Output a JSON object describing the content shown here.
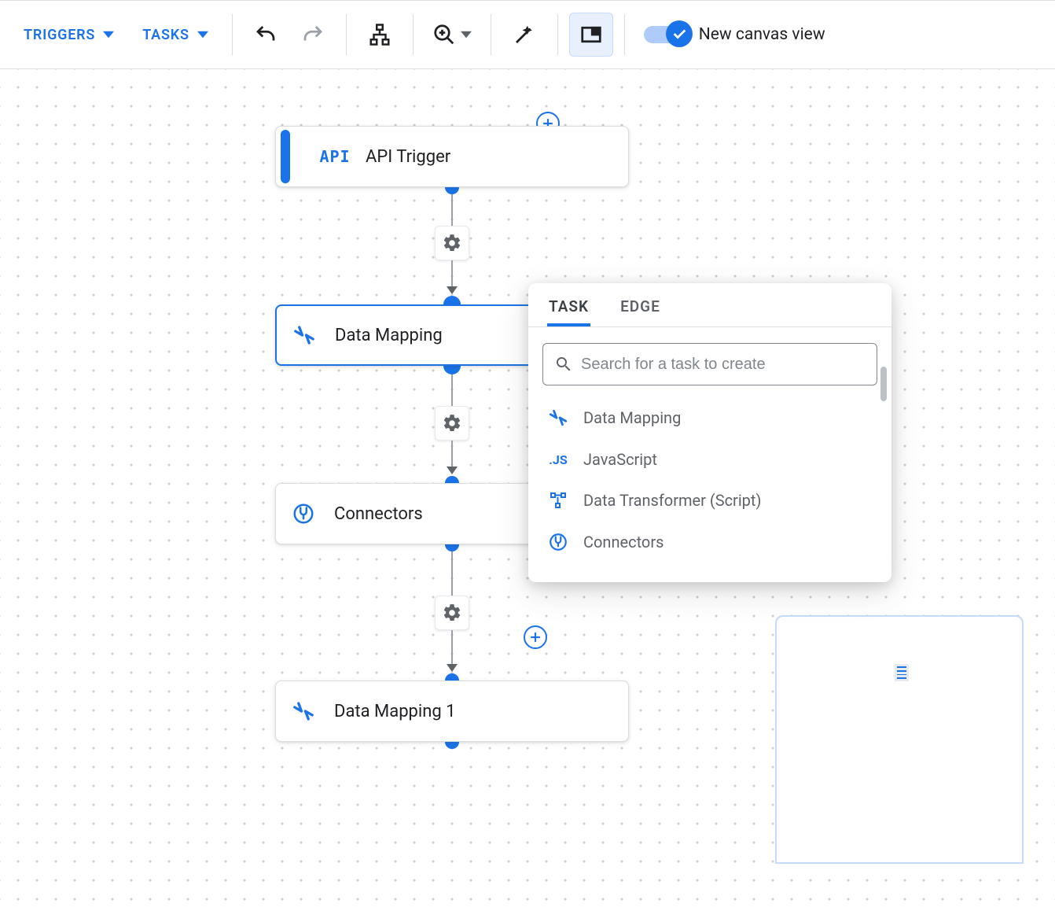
{
  "toolbar": {
    "triggers_label": "TRIGGERS",
    "tasks_label": "TASKS",
    "toggle_label": "New canvas view"
  },
  "nodes": {
    "api_icon_text": "API",
    "api_trigger": "API Trigger",
    "data_mapping": "Data Mapping",
    "connectors": "Connectors",
    "data_mapping_1": "Data Mapping 1"
  },
  "popover": {
    "tab_task": "TASK",
    "tab_edge": "EDGE",
    "search_placeholder": "Search for a task to create",
    "items": {
      "data_mapping": "Data Mapping",
      "javascript_icon": ".JS",
      "javascript": "JavaScript",
      "data_transformer": "Data Transformer (Script)",
      "connectors": "Connectors"
    }
  }
}
